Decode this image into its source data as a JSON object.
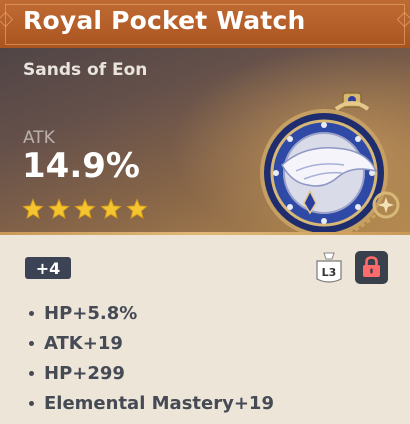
{
  "artifact": {
    "name": "Royal Pocket Watch",
    "set_name": "Sands of Eon",
    "main_stat": {
      "label": "ATK",
      "value": "14.9%"
    },
    "rarity": 5,
    "level": "+4",
    "lock_tag": "L3",
    "locked": true,
    "substats": [
      {
        "text": "HP+5.8%"
      },
      {
        "text": "ATK+19"
      },
      {
        "text": "HP+299"
      },
      {
        "text": "Elemental Mastery+19"
      }
    ]
  },
  "icons": {
    "star": "star-icon",
    "lock": "lock-icon",
    "tag": "tag-icon",
    "artifact": "pocket-watch-artwork"
  },
  "colors": {
    "title_bar": "#b35d29",
    "star": "#f4c531",
    "lock": "#ff6b6b",
    "text_dark": "#454a55",
    "badge_bg": "#3b4355",
    "panel_bg": "#ece5d8"
  }
}
